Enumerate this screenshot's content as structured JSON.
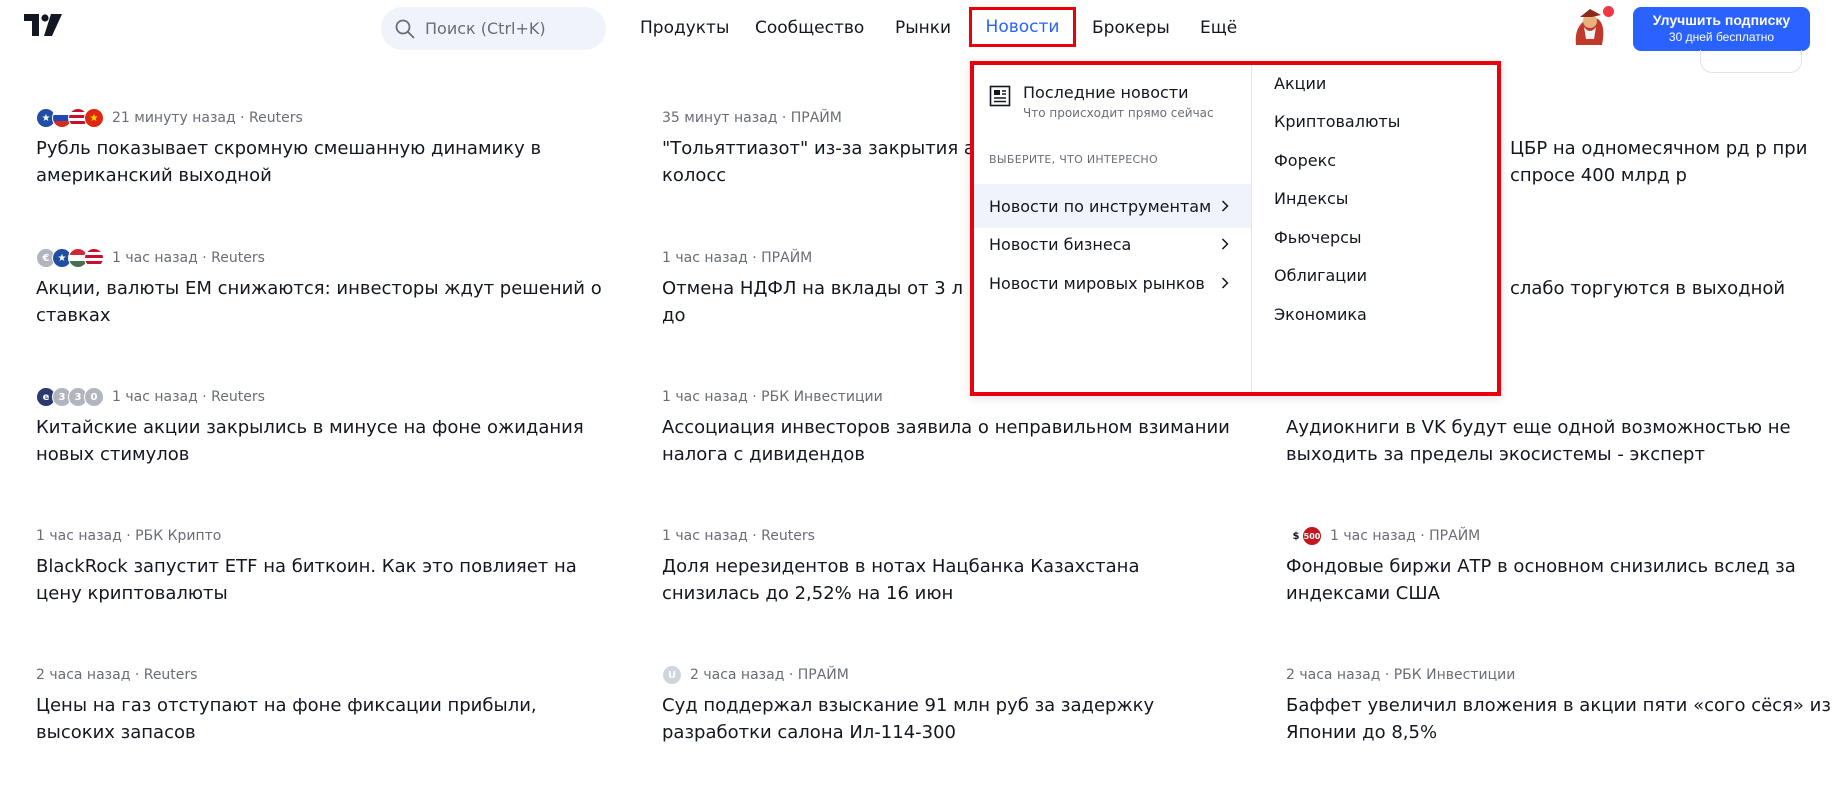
{
  "header": {
    "search_placeholder": "Поиск (Ctrl+K)",
    "nav": [
      "Продукты",
      "Сообщество",
      "Рынки",
      "Новости",
      "Брокеры",
      "Ещё"
    ],
    "active_nav": "Новости",
    "upgrade_line1": "Улучшить подписку",
    "upgrade_line2": "30 дней бесплатно",
    "accent_color": "#2962ff"
  },
  "news": [
    {
      "meta": "21 минуту назад · Reuters",
      "title": "Рубль показывает скромную смешанную динамику в американский выходной"
    },
    {
      "meta": "35 минут назад · ПРАЙМ",
      "title": "\"Тольяттиазот\" из-за закрытия а \"Тольятти-Одесса\" несет колосс"
    },
    {
      "meta": "",
      "title": "ЦБР на одномесячном рд р при спросе 400 млрд р"
    },
    {
      "meta": "1 час назад · Reuters",
      "title": "Акции, валюты ЕМ снижаются: инвесторы ждут решений о ставках"
    },
    {
      "meta": "1 час назад · ПРАЙМ",
      "title": "Отмена НДФЛ на вклады от 3 л млрд руб бюджет-2023, что до"
    },
    {
      "meta": "",
      "title": "слабо торгуются в выходной"
    },
    {
      "meta": "1 час назад · Reuters",
      "title": "Китайские акции закрылись в минусе на фоне ожидания новых стимулов"
    },
    {
      "meta": "1 час назад · РБК Инвестиции",
      "title": "Ассоциация инвесторов заявила о неправильном взимании налога с дивидендов"
    },
    {
      "meta": "",
      "title": "Аудиокниги в VK будут еще одной возможностью не выходить за пределы экосистемы - эксперт"
    },
    {
      "meta": "1 час назад · РБК Крипто",
      "title": "BlackRock запустит ETF на биткоин. Как это повлияет на цену криптовалюты"
    },
    {
      "meta": "1 час назад · Reuters",
      "title": "Доля нерезидентов в нотах Нацбанка Казахстана снизилась до 2,52% на 16 июн"
    },
    {
      "meta": "1 час назад · ПРАЙМ",
      "title": "Фондовые биржи АТР в основном снизились вслед за индексами США"
    },
    {
      "meta": "2 часа назад · Reuters",
      "title": "Цены на газ отступают на фоне фиксации прибыли, высоких запасов"
    },
    {
      "meta": "2 часа назад · ПРАЙМ",
      "title": "Суд поддержал взыскание 91 млн руб за задержку разработки салона Ил-114-300"
    },
    {
      "meta": "2 часа назад · РБК Инвестиции",
      "title": "Баффет увеличил вложения в акции пяти «сого сёся» из Японии до 8,5%"
    }
  ],
  "badges": {
    "sp500": "500",
    "dollar": "$",
    "euro": "€",
    "u": "U"
  },
  "dropdown": {
    "latest_title": "Последние новости",
    "latest_sub": "Что происходит прямо сейчас",
    "caption": "ВЫБЕРИТЕ, ЧТО ИНТЕРЕСНО",
    "left_items": [
      "Новости по инструментам",
      "Новости бизнеса",
      "Новости мировых рынков"
    ],
    "right_items": [
      "Акции",
      "Криптовалюты",
      "Форекс",
      "Индексы",
      "Фьючерсы",
      "Облигации",
      "Экономика"
    ],
    "highlight_color": "#e8000b"
  }
}
